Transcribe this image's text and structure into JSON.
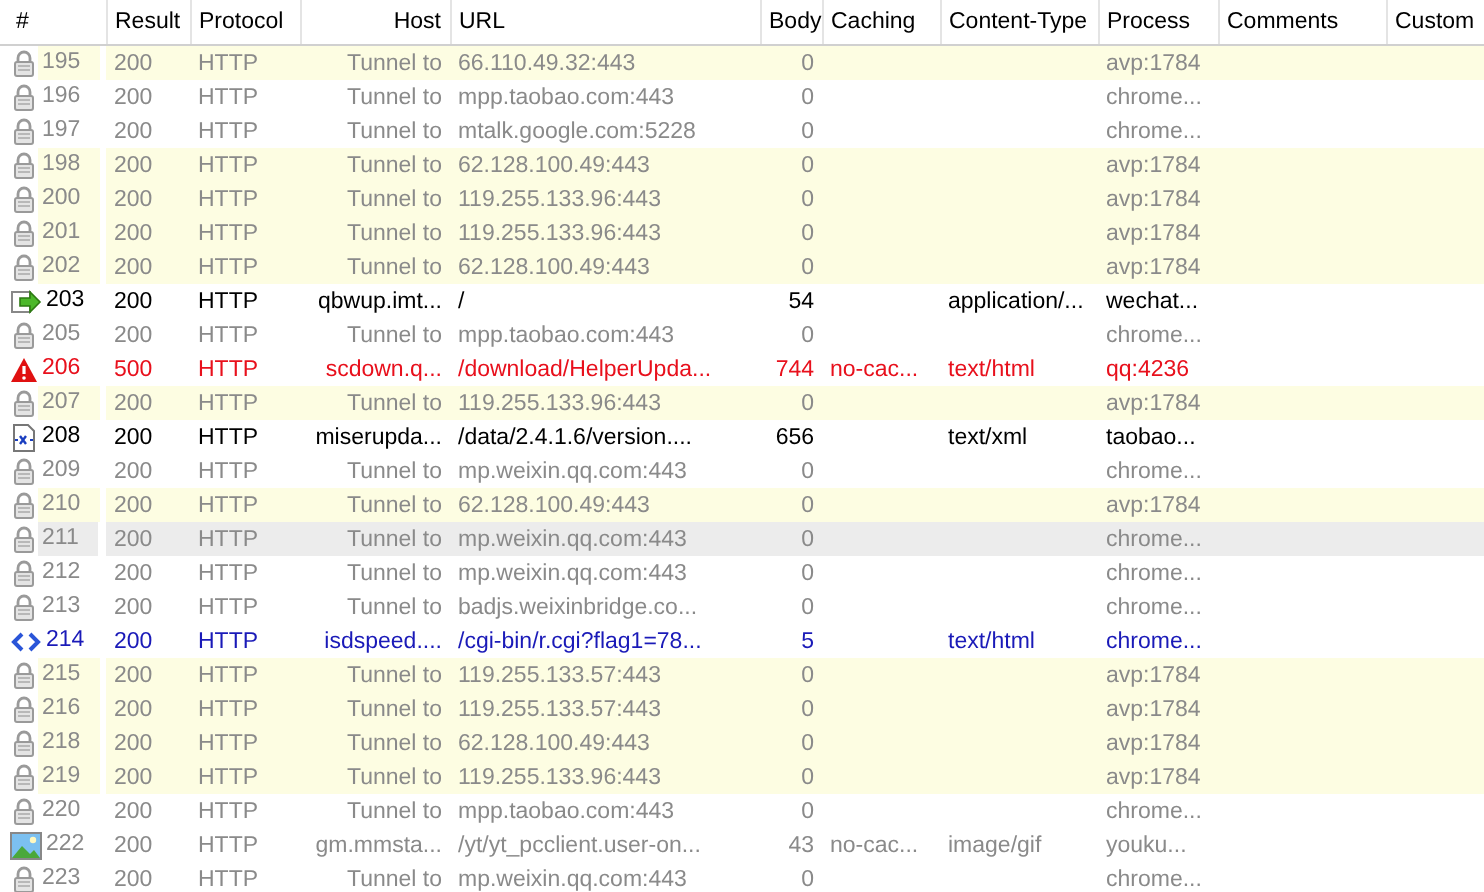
{
  "columns": [
    "#",
    "Result",
    "Protocol",
    "Host",
    "URL",
    "Body",
    "Caching",
    "Content-Type",
    "Process",
    "Comments",
    "Custom"
  ],
  "rows": [
    {
      "kind": "tunnel",
      "number": "195",
      "result": "200",
      "protocol": "HTTP",
      "host": "Tunnel to",
      "url": "66.110.49.32:443",
      "body": "0",
      "process": "avp:1784",
      "marked": true,
      "selected": false
    },
    {
      "kind": "tunnel",
      "number": "196",
      "result": "200",
      "protocol": "HTTP",
      "host": "Tunnel to",
      "url": "mpp.taobao.com:443",
      "body": "0",
      "process": "chrome...",
      "marked": false,
      "selected": false
    },
    {
      "kind": "tunnel",
      "number": "197",
      "result": "200",
      "protocol": "HTTP",
      "host": "Tunnel to",
      "url": "mtalk.google.com:5228",
      "body": "0",
      "process": "chrome...",
      "marked": false,
      "selected": false
    },
    {
      "kind": "tunnel",
      "number": "198",
      "result": "200",
      "protocol": "HTTP",
      "host": "Tunnel to",
      "url": "62.128.100.49:443",
      "body": "0",
      "process": "avp:1784",
      "marked": true,
      "selected": false
    },
    {
      "kind": "tunnel",
      "number": "200",
      "result": "200",
      "protocol": "HTTP",
      "host": "Tunnel to",
      "url": "119.255.133.96:443",
      "body": "0",
      "process": "avp:1784",
      "marked": true,
      "selected": false
    },
    {
      "kind": "tunnel",
      "number": "201",
      "result": "200",
      "protocol": "HTTP",
      "host": "Tunnel to",
      "url": "119.255.133.96:443",
      "body": "0",
      "process": "avp:1784",
      "marked": true,
      "selected": false
    },
    {
      "kind": "tunnel",
      "number": "202",
      "result": "200",
      "protocol": "HTTP",
      "host": "Tunnel to",
      "url": "62.128.100.49:443",
      "body": "0",
      "process": "avp:1784",
      "marked": true,
      "selected": false
    },
    {
      "kind": "response",
      "number": "203",
      "result": "200",
      "protocol": "HTTP",
      "host": "qbwup.imt...",
      "url": "/",
      "body": "54",
      "content_type": "application/...",
      "process": "wechat...",
      "marked": false,
      "selected": false
    },
    {
      "kind": "tunnel",
      "number": "205",
      "result": "200",
      "protocol": "HTTP",
      "host": "Tunnel to",
      "url": "mpp.taobao.com:443",
      "body": "0",
      "process": "chrome...",
      "marked": false,
      "selected": false
    },
    {
      "kind": "error",
      "number": "206",
      "result": "500",
      "protocol": "HTTP",
      "host": "scdown.q...",
      "url": "/download/HelperUpda...",
      "body": "744",
      "caching": "no-cac...",
      "content_type": "text/html",
      "process": "qq:4236",
      "marked": false,
      "selected": false
    },
    {
      "kind": "tunnel",
      "number": "207",
      "result": "200",
      "protocol": "HTTP",
      "host": "Tunnel to",
      "url": "119.255.133.96:443",
      "body": "0",
      "process": "avp:1784",
      "marked": true,
      "selected": false
    },
    {
      "kind": "xml",
      "number": "208",
      "result": "200",
      "protocol": "HTTP",
      "host": "miserupda...",
      "url": "/data/2.4.1.6/version....",
      "body": "656",
      "content_type": "text/xml",
      "process": "taobao...",
      "marked": false,
      "selected": false
    },
    {
      "kind": "tunnel",
      "number": "209",
      "result": "200",
      "protocol": "HTTP",
      "host": "Tunnel to",
      "url": "mp.weixin.qq.com:443",
      "body": "0",
      "process": "chrome...",
      "marked": false,
      "selected": false
    },
    {
      "kind": "tunnel",
      "number": "210",
      "result": "200",
      "protocol": "HTTP",
      "host": "Tunnel to",
      "url": "62.128.100.49:443",
      "body": "0",
      "process": "avp:1784",
      "marked": true,
      "selected": false
    },
    {
      "kind": "tunnel",
      "number": "211",
      "result": "200",
      "protocol": "HTTP",
      "host": "Tunnel to",
      "url": "mp.weixin.qq.com:443",
      "body": "0",
      "process": "chrome...",
      "marked": false,
      "selected": true
    },
    {
      "kind": "tunnel",
      "number": "212",
      "result": "200",
      "protocol": "HTTP",
      "host": "Tunnel to",
      "url": "mp.weixin.qq.com:443",
      "body": "0",
      "process": "chrome...",
      "marked": false,
      "selected": false
    },
    {
      "kind": "tunnel",
      "number": "213",
      "result": "200",
      "protocol": "HTTP",
      "host": "Tunnel to",
      "url": "badjs.weixinbridge.co...",
      "body": "0",
      "process": "chrome...",
      "marked": false,
      "selected": false
    },
    {
      "kind": "script",
      "number": "214",
      "result": "200",
      "protocol": "HTTP",
      "host": "isdspeed....",
      "url": "/cgi-bin/r.cgi?flag1=78...",
      "body": "5",
      "content_type": "text/html",
      "process": "chrome...",
      "marked": false,
      "selected": false
    },
    {
      "kind": "tunnel",
      "number": "215",
      "result": "200",
      "protocol": "HTTP",
      "host": "Tunnel to",
      "url": "119.255.133.57:443",
      "body": "0",
      "process": "avp:1784",
      "marked": true,
      "selected": false
    },
    {
      "kind": "tunnel",
      "number": "216",
      "result": "200",
      "protocol": "HTTP",
      "host": "Tunnel to",
      "url": "119.255.133.57:443",
      "body": "0",
      "process": "avp:1784",
      "marked": true,
      "selected": false
    },
    {
      "kind": "tunnel",
      "number": "218",
      "result": "200",
      "protocol": "HTTP",
      "host": "Tunnel to",
      "url": "62.128.100.49:443",
      "body": "0",
      "process": "avp:1784",
      "marked": true,
      "selected": false
    },
    {
      "kind": "tunnel",
      "number": "219",
      "result": "200",
      "protocol": "HTTP",
      "host": "Tunnel to",
      "url": "119.255.133.96:443",
      "body": "0",
      "process": "avp:1784",
      "marked": true,
      "selected": false
    },
    {
      "kind": "tunnel",
      "number": "220",
      "result": "200",
      "protocol": "HTTP",
      "host": "Tunnel to",
      "url": "mpp.taobao.com:443",
      "body": "0",
      "process": "chrome...",
      "marked": false,
      "selected": false
    },
    {
      "kind": "image",
      "number": "222",
      "result": "200",
      "protocol": "HTTP",
      "host": "gm.mmsta...",
      "url": "/yt/yt_pcclient.user-on...",
      "body": "43",
      "caching": "no-cac...",
      "content_type": "image/gif",
      "process": "youku...",
      "marked": false,
      "selected": false
    },
    {
      "kind": "tunnel",
      "number": "223",
      "result": "200",
      "protocol": "HTTP",
      "host": "Tunnel to",
      "url": "mp.weixin.qq.com:443",
      "body": "0",
      "process": "chrome...",
      "marked": false,
      "selected": false
    }
  ]
}
